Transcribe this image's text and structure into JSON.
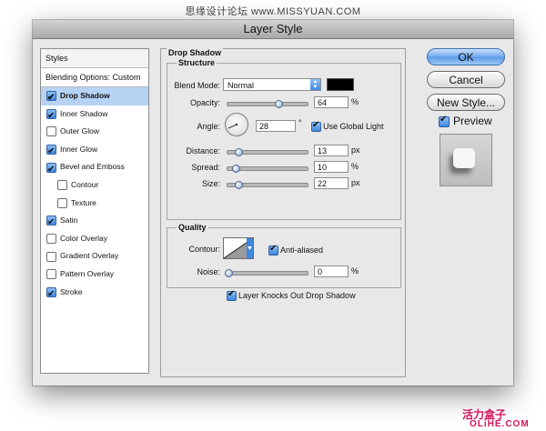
{
  "watermark": "思缘设计论坛 www.MISSYUAN.COM",
  "window": {
    "title": "Layer Style"
  },
  "sidebar": {
    "header": "Styles",
    "blending": "Blending Options: Custom",
    "items": [
      {
        "label": "Drop Shadow",
        "checked": true,
        "active": true
      },
      {
        "label": "Inner Shadow",
        "checked": true
      },
      {
        "label": "Outer Glow",
        "checked": false
      },
      {
        "label": "Inner Glow",
        "checked": true
      },
      {
        "label": "Bevel and Emboss",
        "checked": true
      },
      {
        "label": "Contour",
        "checked": false,
        "sub": true
      },
      {
        "label": "Texture",
        "checked": false,
        "sub": true
      },
      {
        "label": "Satin",
        "checked": true
      },
      {
        "label": "Color Overlay",
        "checked": false
      },
      {
        "label": "Gradient Overlay",
        "checked": false
      },
      {
        "label": "Pattern Overlay",
        "checked": false
      },
      {
        "label": "Stroke",
        "checked": true
      }
    ]
  },
  "panel": {
    "title": "Drop Shadow",
    "structure": {
      "title": "Structure",
      "blend_mode_label": "Blend Mode:",
      "blend_mode_value": "Normal",
      "shadow_color": "#000000",
      "opacity_label": "Opacity:",
      "opacity_value": "64",
      "opacity_unit": "%",
      "angle_label": "Angle:",
      "angle_value": "28",
      "angle_unit": "°",
      "use_global_light_label": "Use Global Light",
      "use_global_light": true,
      "distance_label": "Distance:",
      "distance_value": "13",
      "distance_unit": "px",
      "spread_label": "Spread:",
      "spread_value": "10",
      "spread_unit": "%",
      "size_label": "Size:",
      "size_value": "22",
      "size_unit": "px"
    },
    "quality": {
      "title": "Quality",
      "contour_label": "Contour:",
      "anti_aliased_label": "Anti-aliased",
      "anti_aliased": true,
      "noise_label": "Noise:",
      "noise_value": "0",
      "noise_unit": "%"
    },
    "knockout_label": "Layer Knocks Out Drop Shadow",
    "knockout": true
  },
  "buttons": {
    "ok": "OK",
    "cancel": "Cancel",
    "new_style": "New Style...",
    "preview_label": "Preview",
    "preview_checked": true
  },
  "logo": {
    "cn": "活力盒子",
    "en": "OLiHE.COM"
  }
}
